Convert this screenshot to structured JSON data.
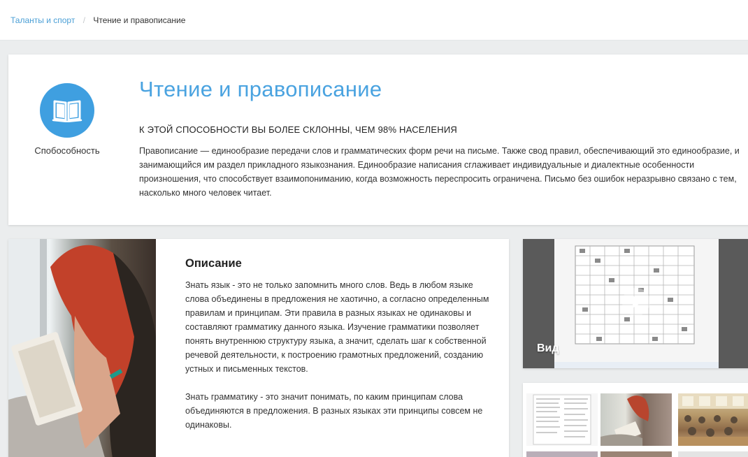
{
  "breadcrumb": {
    "parent": "Таланты и спорт",
    "separator": "/",
    "current": "Чтение и правописание"
  },
  "header": {
    "icon": "open-book-icon",
    "ability_label": "Спобособность",
    "title": "Чтение и правописание",
    "tendency": "К этой способности вы более склонны, чем 98% населения",
    "intro": "Правописание — единообразие передачи слов и грамматических форм речи на письме. Также свод правил, обеспечивающий это единообразие, и занимающийся им раздел прикладного языкознания. Единообразие написания сглаживает индивидуальные и диалектные особенности произношения, что способствует взаимопониманию, когда возможность переспросить ограничена. Письмо без ошибок неразрывно связано с тем, насколько много человек читает."
  },
  "description": {
    "title": "Описание",
    "paragraphs": [
      "Знать язык - это не только запомнить много слов. Ведь в любом языке слова объединены в предложения не хаотично, а согласно определенным правилам и принципам. Эти правила в разных языках не одинаковы и составляют грамматику данного языка. Изучение грамматики позволяет понять внутреннюю структуру языка, а значит, сделать шаг к собственной речевой деятельности, к построению грамотных предложений, созданию устных и письменных текстов.",
      "Знать грамматику - это значит понимать, по каким принципам слова объединяются в предложения. В разных языках эти принципы совсем не одинаковы."
    ]
  },
  "video": {
    "title": "Вид"
  },
  "colors": {
    "accent": "#4aa3e0",
    "icon_bg": "#3f9fe0",
    "link": "#4a9fd6",
    "page_bg": "#ebedee"
  }
}
